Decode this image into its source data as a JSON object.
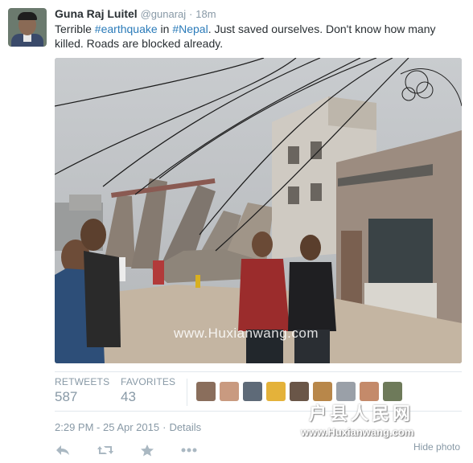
{
  "author": {
    "name": "Guna Raj Luitel",
    "handle": "@gunaraj",
    "separator": "·",
    "time_ago": "18m"
  },
  "tweet": {
    "text_1": "Terrible ",
    "hashtag_1": "#earthquake",
    "text_2": " in ",
    "hashtag_2": "#Nepal",
    "text_3": ". Just saved ourselves. Don't know how many killed. Roads are blocked already."
  },
  "photo": {
    "watermark": "www.Huxianwang.com",
    "hide_label": "Hide photo"
  },
  "stats": {
    "retweets_label": "RETWEETS",
    "retweets_value": "587",
    "favorites_label": "FAVORITES",
    "favorites_value": "43"
  },
  "meta": {
    "timestamp": "2:29 PM - 25 Apr 2015",
    "separator": "·",
    "details_label": "Details"
  },
  "overlay": {
    "logo_text": "户县人民网",
    "url_text": "www.Huxianwang.com"
  },
  "colors": {
    "link": "#2b7bb9",
    "muted": "#8899a6",
    "text": "#292f33",
    "border": "#e1e8ed"
  },
  "icons": [
    "reply-icon",
    "retweet-icon",
    "favorite-icon",
    "more-icon"
  ]
}
